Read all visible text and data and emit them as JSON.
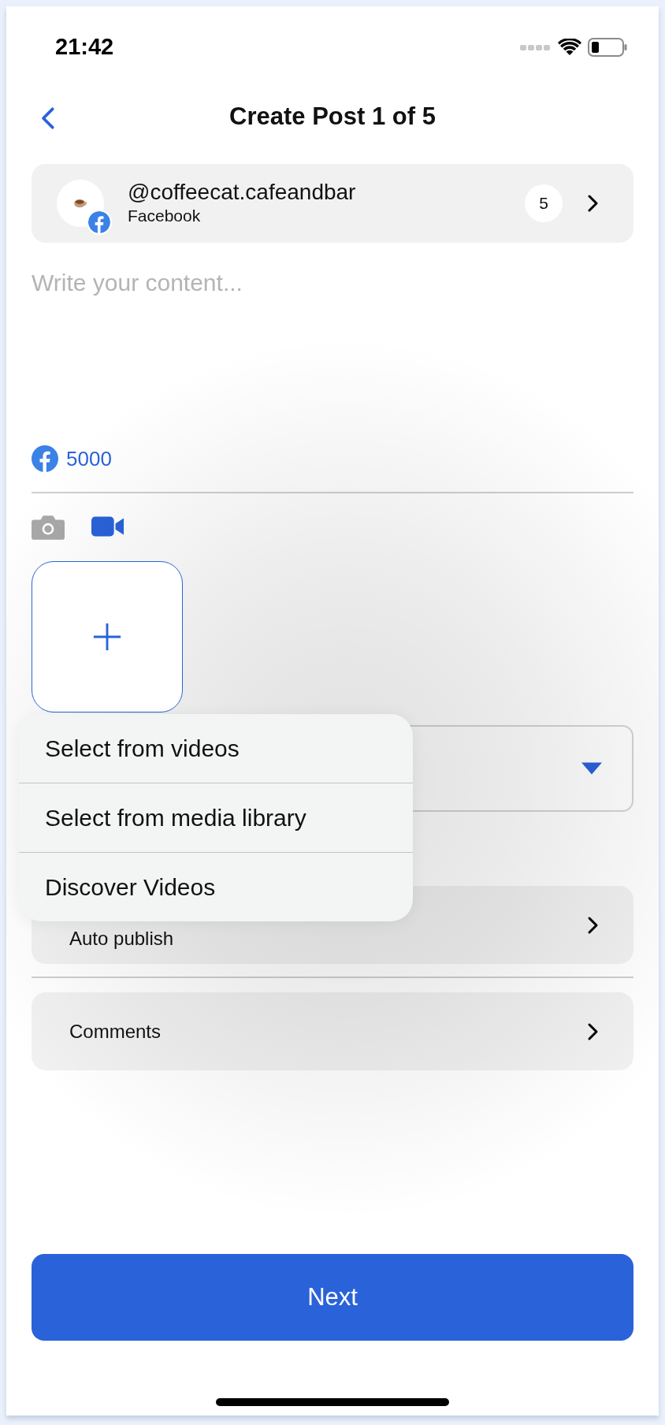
{
  "status_bar": {
    "time": "21:42"
  },
  "header": {
    "title": "Create Post 1 of 5"
  },
  "account": {
    "handle": "@coffeecat.cafeandbar",
    "network": "Facebook",
    "count": "5"
  },
  "composer": {
    "placeholder": "Write your content...",
    "char_limit": "5000"
  },
  "media_tabs": [
    {
      "kind": "photo",
      "selected": false
    },
    {
      "kind": "video",
      "selected": true
    }
  ],
  "popup_menu": [
    {
      "label": "Select from videos"
    },
    {
      "label": "Select from media library"
    },
    {
      "label": "Discover Videos"
    }
  ],
  "settings_rows": [
    {
      "label": "Auto publish"
    },
    {
      "label": "Comments"
    }
  ],
  "next_button": "Next"
}
